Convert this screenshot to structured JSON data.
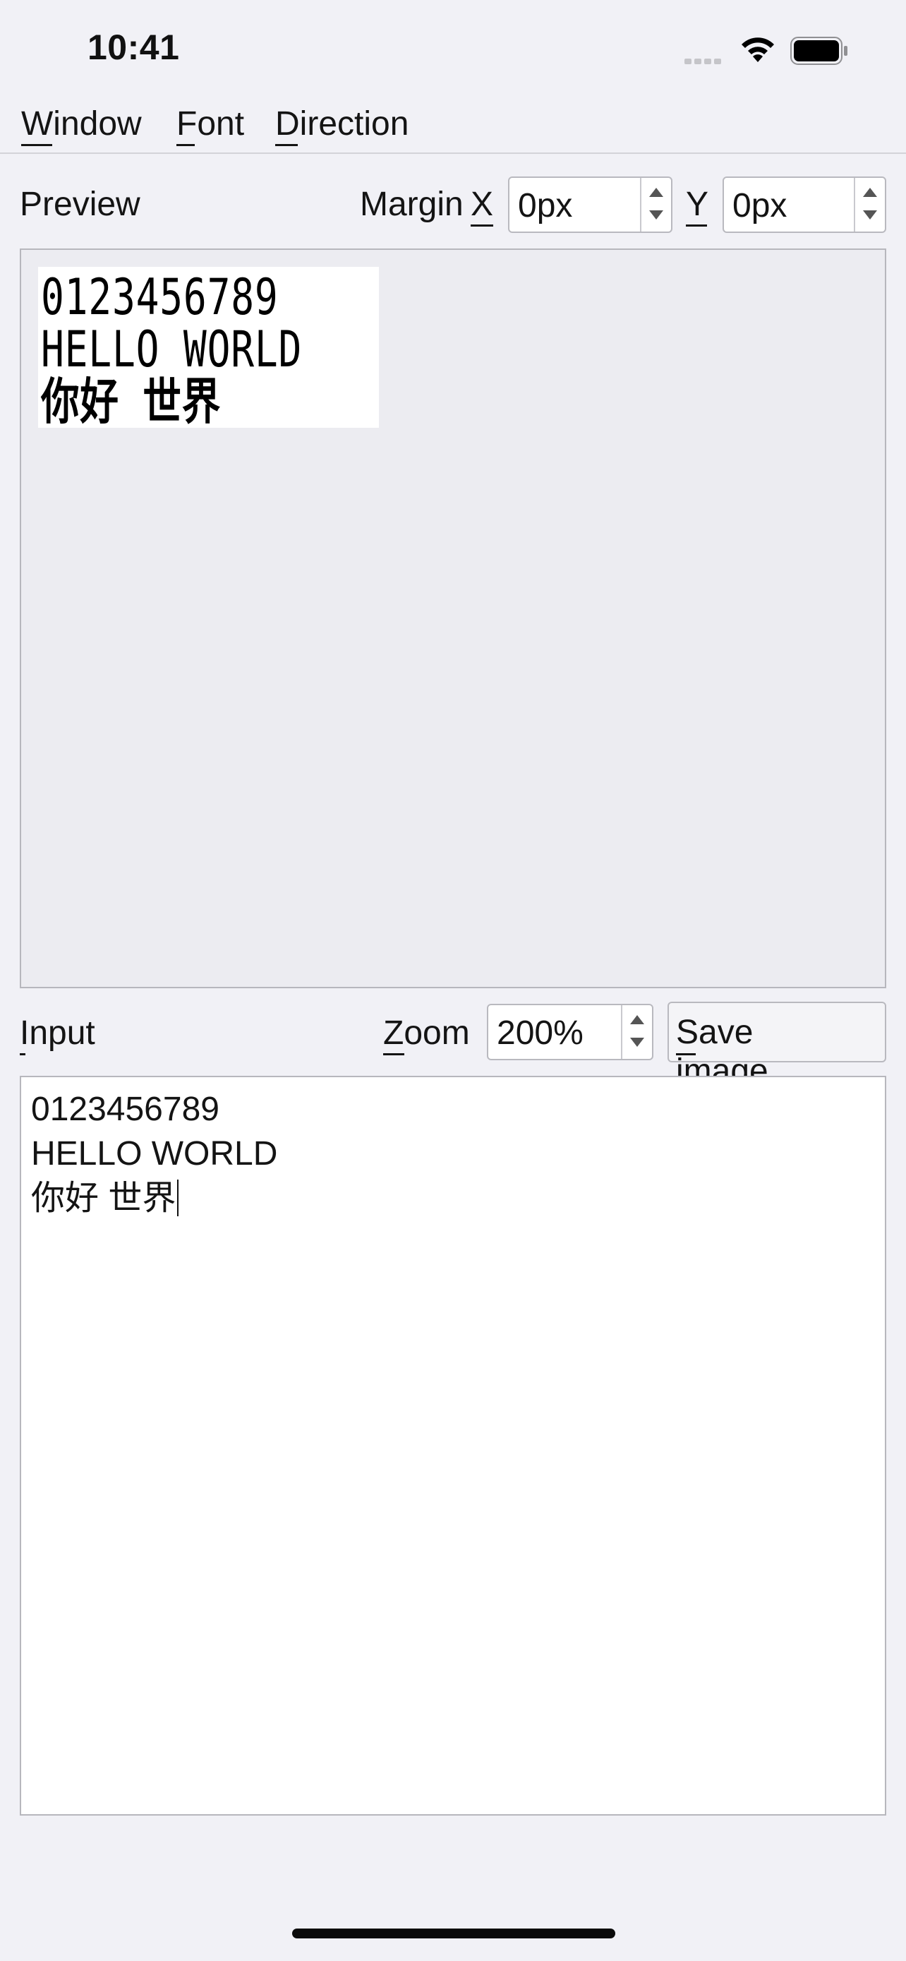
{
  "status_bar": {
    "time": "10:41",
    "icons": [
      "cellular-signal-icon",
      "wifi-icon",
      "battery-icon"
    ]
  },
  "menu": {
    "items": [
      {
        "label": "Window",
        "mnemonic": "W"
      },
      {
        "label": "Font",
        "mnemonic": "F"
      },
      {
        "label": "Direction",
        "mnemonic": "D"
      }
    ]
  },
  "preview": {
    "title": "Preview",
    "margin_label": "Margin",
    "x_label": "X",
    "x_value": "0px",
    "y_label": "Y",
    "y_value": "0px",
    "lines": [
      "0123456789",
      "HELLO WORLD",
      "你好 世界"
    ]
  },
  "input": {
    "title": "Input",
    "zoom_label": "Zoom",
    "zoom_value": "200%",
    "save_button": "Save image...",
    "lines": [
      "0123456789",
      "HELLO WORLD",
      "你好 世界"
    ]
  },
  "colors": {
    "background": "#f1f1f6",
    "panel_border": "#b7b7bd",
    "text": "#141414"
  }
}
